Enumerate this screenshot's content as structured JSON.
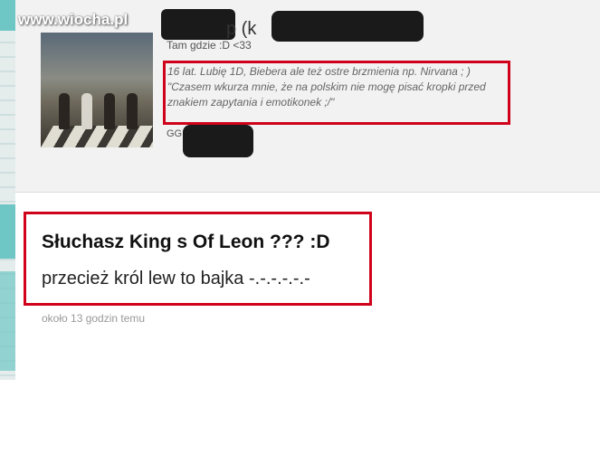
{
  "watermark": "www.wiocha.pl",
  "profile": {
    "name_visible": "p (k",
    "location": "Tam gdzie :D <33",
    "bio": "16 lat. Lubię 1D, Biebera ale też ostre brzmienia np. Nirvana ; ) \"Czasem wkurza mnie, że na polskim nie mogę pisać kropki przed znakiem zapytania i emotikonek ;/\"",
    "gg_label": "GG:"
  },
  "comment": {
    "title": "Słuchasz King s Of Leon ??? :D",
    "body": "przecież król lew to bajka -.-.-.-.-.-",
    "time": "około 13 godzin temu"
  },
  "colors": {
    "highlight_border": "#d0021b",
    "panel_bg": "#f2f2f2",
    "accent_teal": "#6fc7c5"
  }
}
